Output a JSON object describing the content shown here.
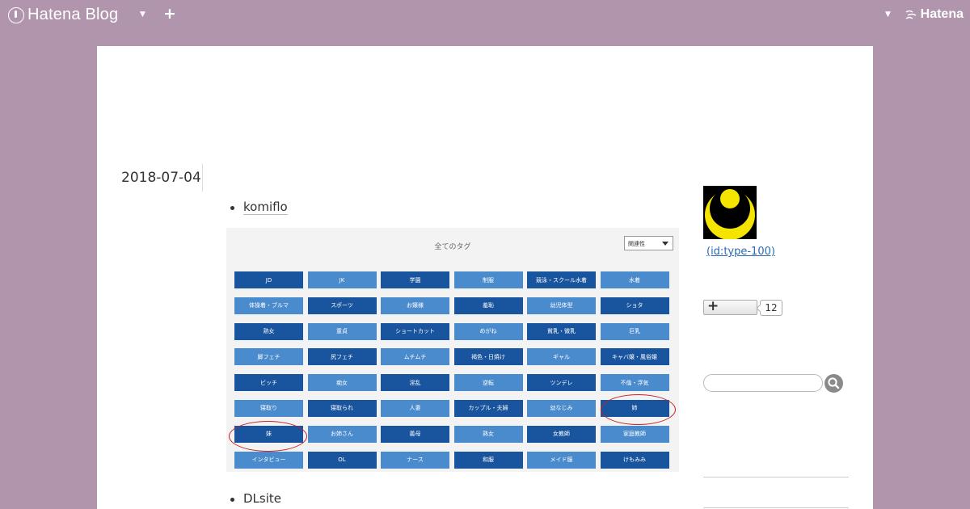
{
  "topbar": {
    "brand": "Hatena Blog",
    "brand_icon": "hatena-blog-logo-icon",
    "add_icon": "+",
    "service_logo": "Hatena"
  },
  "entry": {
    "date": "2018-07-04",
    "first_item": "komiflo",
    "second_item": "DLsite"
  },
  "tag_screenshot": {
    "title": "全てのタグ",
    "sort_label": "関連性",
    "tags": [
      {
        "label": "JD",
        "tone": "dark"
      },
      {
        "label": "JK",
        "tone": "light"
      },
      {
        "label": "学園",
        "tone": "dark"
      },
      {
        "label": "制服",
        "tone": "light"
      },
      {
        "label": "競泳・スクール水着",
        "tone": "dark"
      },
      {
        "label": "水着",
        "tone": "light"
      },
      {
        "label": "体操着・ブルマ",
        "tone": "light"
      },
      {
        "label": "スポーツ",
        "tone": "dark"
      },
      {
        "label": "お嬢様",
        "tone": "light"
      },
      {
        "label": "羞恥",
        "tone": "dark"
      },
      {
        "label": "幼児体型",
        "tone": "light"
      },
      {
        "label": "ショタ",
        "tone": "dark"
      },
      {
        "label": "熟女",
        "tone": "dark"
      },
      {
        "label": "童貞",
        "tone": "light"
      },
      {
        "label": "ショートカット",
        "tone": "dark"
      },
      {
        "label": "めがね",
        "tone": "light"
      },
      {
        "label": "貧乳・微乳",
        "tone": "dark"
      },
      {
        "label": "巨乳",
        "tone": "light"
      },
      {
        "label": "脚フェチ",
        "tone": "light"
      },
      {
        "label": "尻フェチ",
        "tone": "dark"
      },
      {
        "label": "ムチムチ",
        "tone": "light"
      },
      {
        "label": "褐色・日焼け",
        "tone": "dark"
      },
      {
        "label": "ギャル",
        "tone": "light"
      },
      {
        "label": "キャバ嬢・風俗嬢",
        "tone": "dark"
      },
      {
        "label": "ビッチ",
        "tone": "dark"
      },
      {
        "label": "痴女",
        "tone": "light"
      },
      {
        "label": "淫乱",
        "tone": "dark"
      },
      {
        "label": "逆転",
        "tone": "light"
      },
      {
        "label": "ツンデレ",
        "tone": "dark"
      },
      {
        "label": "不倫・浮気",
        "tone": "light"
      },
      {
        "label": "寝取り",
        "tone": "light"
      },
      {
        "label": "寝取られ",
        "tone": "dark"
      },
      {
        "label": "人妻",
        "tone": "light"
      },
      {
        "label": "カップル・夫婦",
        "tone": "dark"
      },
      {
        "label": "幼なじみ",
        "tone": "light"
      },
      {
        "label": "姉",
        "tone": "dark"
      },
      {
        "label": "妹",
        "tone": "dark"
      },
      {
        "label": "お姉さん",
        "tone": "light"
      },
      {
        "label": "義母",
        "tone": "dark"
      },
      {
        "label": "熟女",
        "tone": "light"
      },
      {
        "label": "女教師",
        "tone": "dark"
      },
      {
        "label": "家庭教師",
        "tone": "light"
      },
      {
        "label": "インタビュー",
        "tone": "light"
      },
      {
        "label": "OL",
        "tone": "dark"
      },
      {
        "label": "ナース",
        "tone": "light"
      },
      {
        "label": "和服",
        "tone": "dark"
      },
      {
        "label": "メイド服",
        "tone": "light"
      },
      {
        "label": "けもみみ",
        "tone": "dark"
      }
    ]
  },
  "sidebar": {
    "user_id": "(id:type-100)",
    "star_icon": "+",
    "star_count": "12",
    "search_icon": "search-icon"
  },
  "colors": {
    "background": "#b095ad",
    "tag_dark": "#19559e",
    "tag_light": "#4a8bcd",
    "highlight_ring": "#cc1f1f",
    "link": "#2a6cb5"
  }
}
